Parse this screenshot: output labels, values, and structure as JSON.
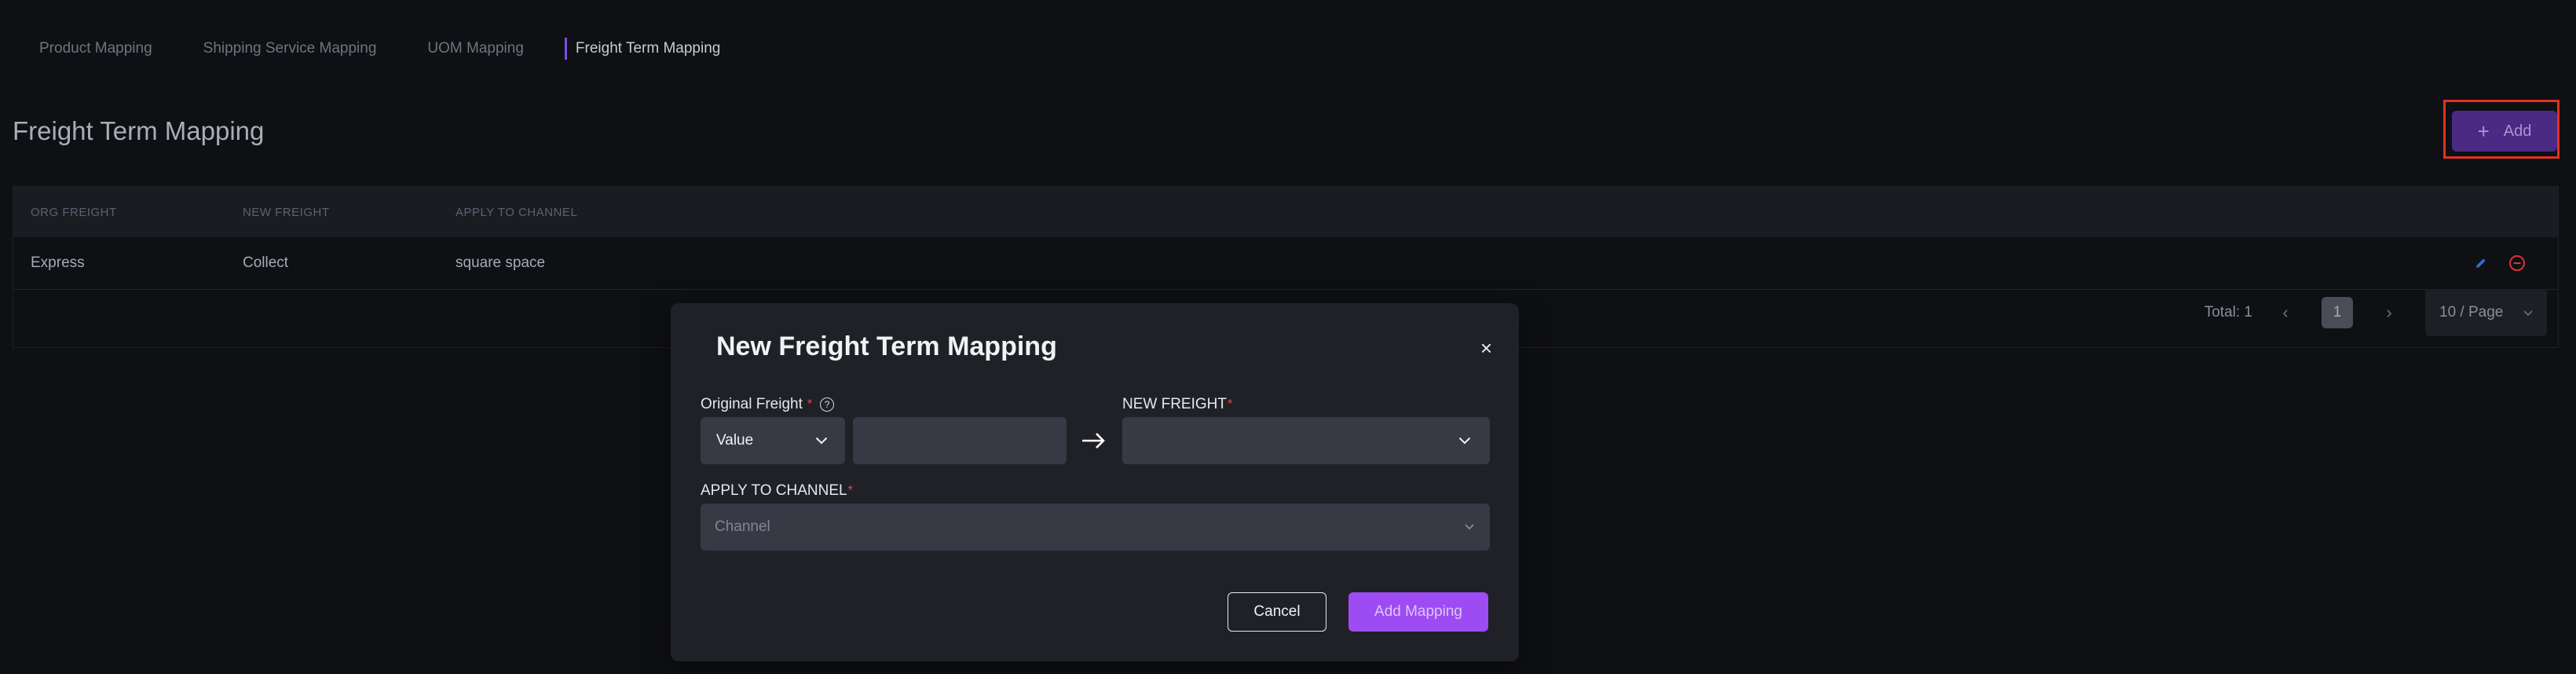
{
  "tabs": [
    {
      "label": "Product Mapping"
    },
    {
      "label": "Shipping Service Mapping"
    },
    {
      "label": "UOM Mapping"
    },
    {
      "label": "Freight Term Mapping"
    }
  ],
  "active_tab": "Freight Term Mapping",
  "page": {
    "title": "Freight Term Mapping",
    "add_label": "Add"
  },
  "table": {
    "columns": [
      "ORG FREIGHT",
      "NEW FREIGHT",
      "APPLY TO CHANNEL"
    ],
    "rows": [
      {
        "org_freight": "Express",
        "new_freight": "Collect",
        "channel": "square space"
      }
    ]
  },
  "pagination": {
    "total": "Total: 1",
    "prev_icon": "‹",
    "next_icon": "›",
    "current_page": "1",
    "page_size": "10 / Page"
  },
  "modal": {
    "title": "New Freight Term Mapping",
    "close_icon": "×",
    "original_freight_label": "Original Freight",
    "required_mark": "*",
    "help_icon": "?",
    "type_value": "Value",
    "original_value": "",
    "new_freight_label": "NEW FREIGHT",
    "new_freight_value": "",
    "channel_label": "APPLY TO CHANNEL",
    "channel_placeholder": "Channel",
    "cancel_label": "Cancel",
    "submit_label": "Add Mapping"
  },
  "colors": {
    "accent": "#9d4bf2",
    "add_button": "#4b2a84",
    "required": "#e5484d",
    "edit_icon": "#2f6fc9",
    "delete_icon": "#d6333d",
    "highlight": "#e0321f"
  }
}
